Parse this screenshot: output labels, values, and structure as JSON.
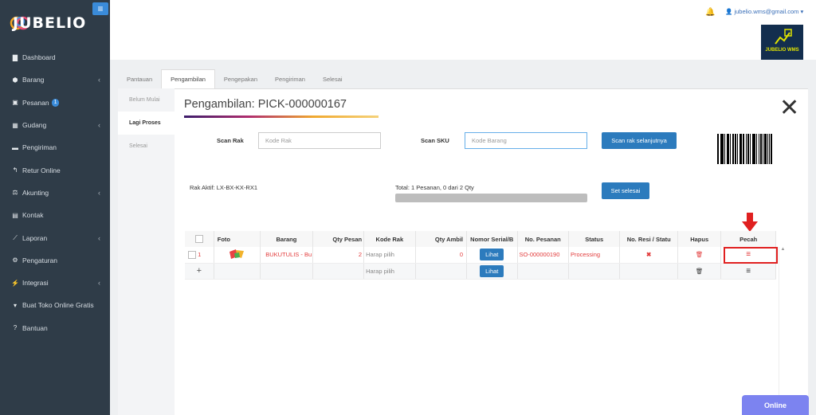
{
  "brand": {
    "name": "JUBELIO",
    "wms_label": "JUBELIO WMS"
  },
  "topbar": {
    "user_email": "jubelio.wms@gmail.com"
  },
  "sidebar": {
    "items": [
      {
        "label": "Dashboard",
        "icon": "chart-icon",
        "chevron": false
      },
      {
        "label": "Barang",
        "icon": "box-icon",
        "chevron": true
      },
      {
        "label": "Pesanan",
        "icon": "bag-icon",
        "chevron": false,
        "badge": "1"
      },
      {
        "label": "Gudang",
        "icon": "building-icon",
        "chevron": true
      },
      {
        "label": "Pengiriman",
        "icon": "truck-icon",
        "chevron": false
      },
      {
        "label": "Retur Online",
        "icon": "reply-icon",
        "chevron": false
      },
      {
        "label": "Akunting",
        "icon": "scale-icon",
        "chevron": true
      },
      {
        "label": "Kontak",
        "icon": "contact-icon",
        "chevron": false
      },
      {
        "label": "Laporan",
        "icon": "line-chart-icon",
        "chevron": true
      },
      {
        "label": "Pengaturan",
        "icon": "gears-icon",
        "chevron": false
      },
      {
        "label": "Integrasi",
        "icon": "plug-icon",
        "chevron": true
      },
      {
        "label": "Buat Toko Online Gratis",
        "icon": "cart-icon",
        "chevron": false
      },
      {
        "label": "Bantuan",
        "icon": "help-icon",
        "chevron": false
      }
    ]
  },
  "tabs": [
    "Pantauan",
    "Pengambilan",
    "Pengepakan",
    "Pengiriman",
    "Selesai"
  ],
  "left_nav": [
    "Belum Mulai",
    "Lagi Proses",
    "Selesai"
  ],
  "main": {
    "title": "Pengambilan: PICK-000000167",
    "scan_rak_label": "Scan Rak",
    "scan_rak_placeholder": "Kode Rak",
    "scan_sku_label": "Scan SKU",
    "scan_sku_placeholder": "Kode Barang",
    "next_rack_button": "Scan rak selanjutnya",
    "active_rack": "Rak Aktif: LX-BX-KX-RX1",
    "total": "Total: 1 Pesanan, 0 dari 2 Qty",
    "progress": 0,
    "finish_button": "Set selesai"
  },
  "table": {
    "headers": [
      "Foto",
      "Barang",
      "Qty Pesan",
      "Kode Rak",
      "Qty Ambil",
      "Nomor Serial/B",
      "No. Pesanan",
      "Status",
      "No. Resi / Statu",
      "Hapus",
      "Pecah"
    ],
    "rows": [
      {
        "no": "1",
        "barang": "BUKUTULIS - Bu",
        "qty_pesan": "2",
        "kode_rak": "Harap pilih",
        "qty_ambil": "0",
        "serial": "Lihat",
        "no_pesanan": "SO-000000190",
        "status": "Processing"
      },
      {
        "no": "+",
        "kode_rak": "Harap pilih",
        "serial": "Lihat"
      }
    ]
  },
  "online_label": "Online"
}
